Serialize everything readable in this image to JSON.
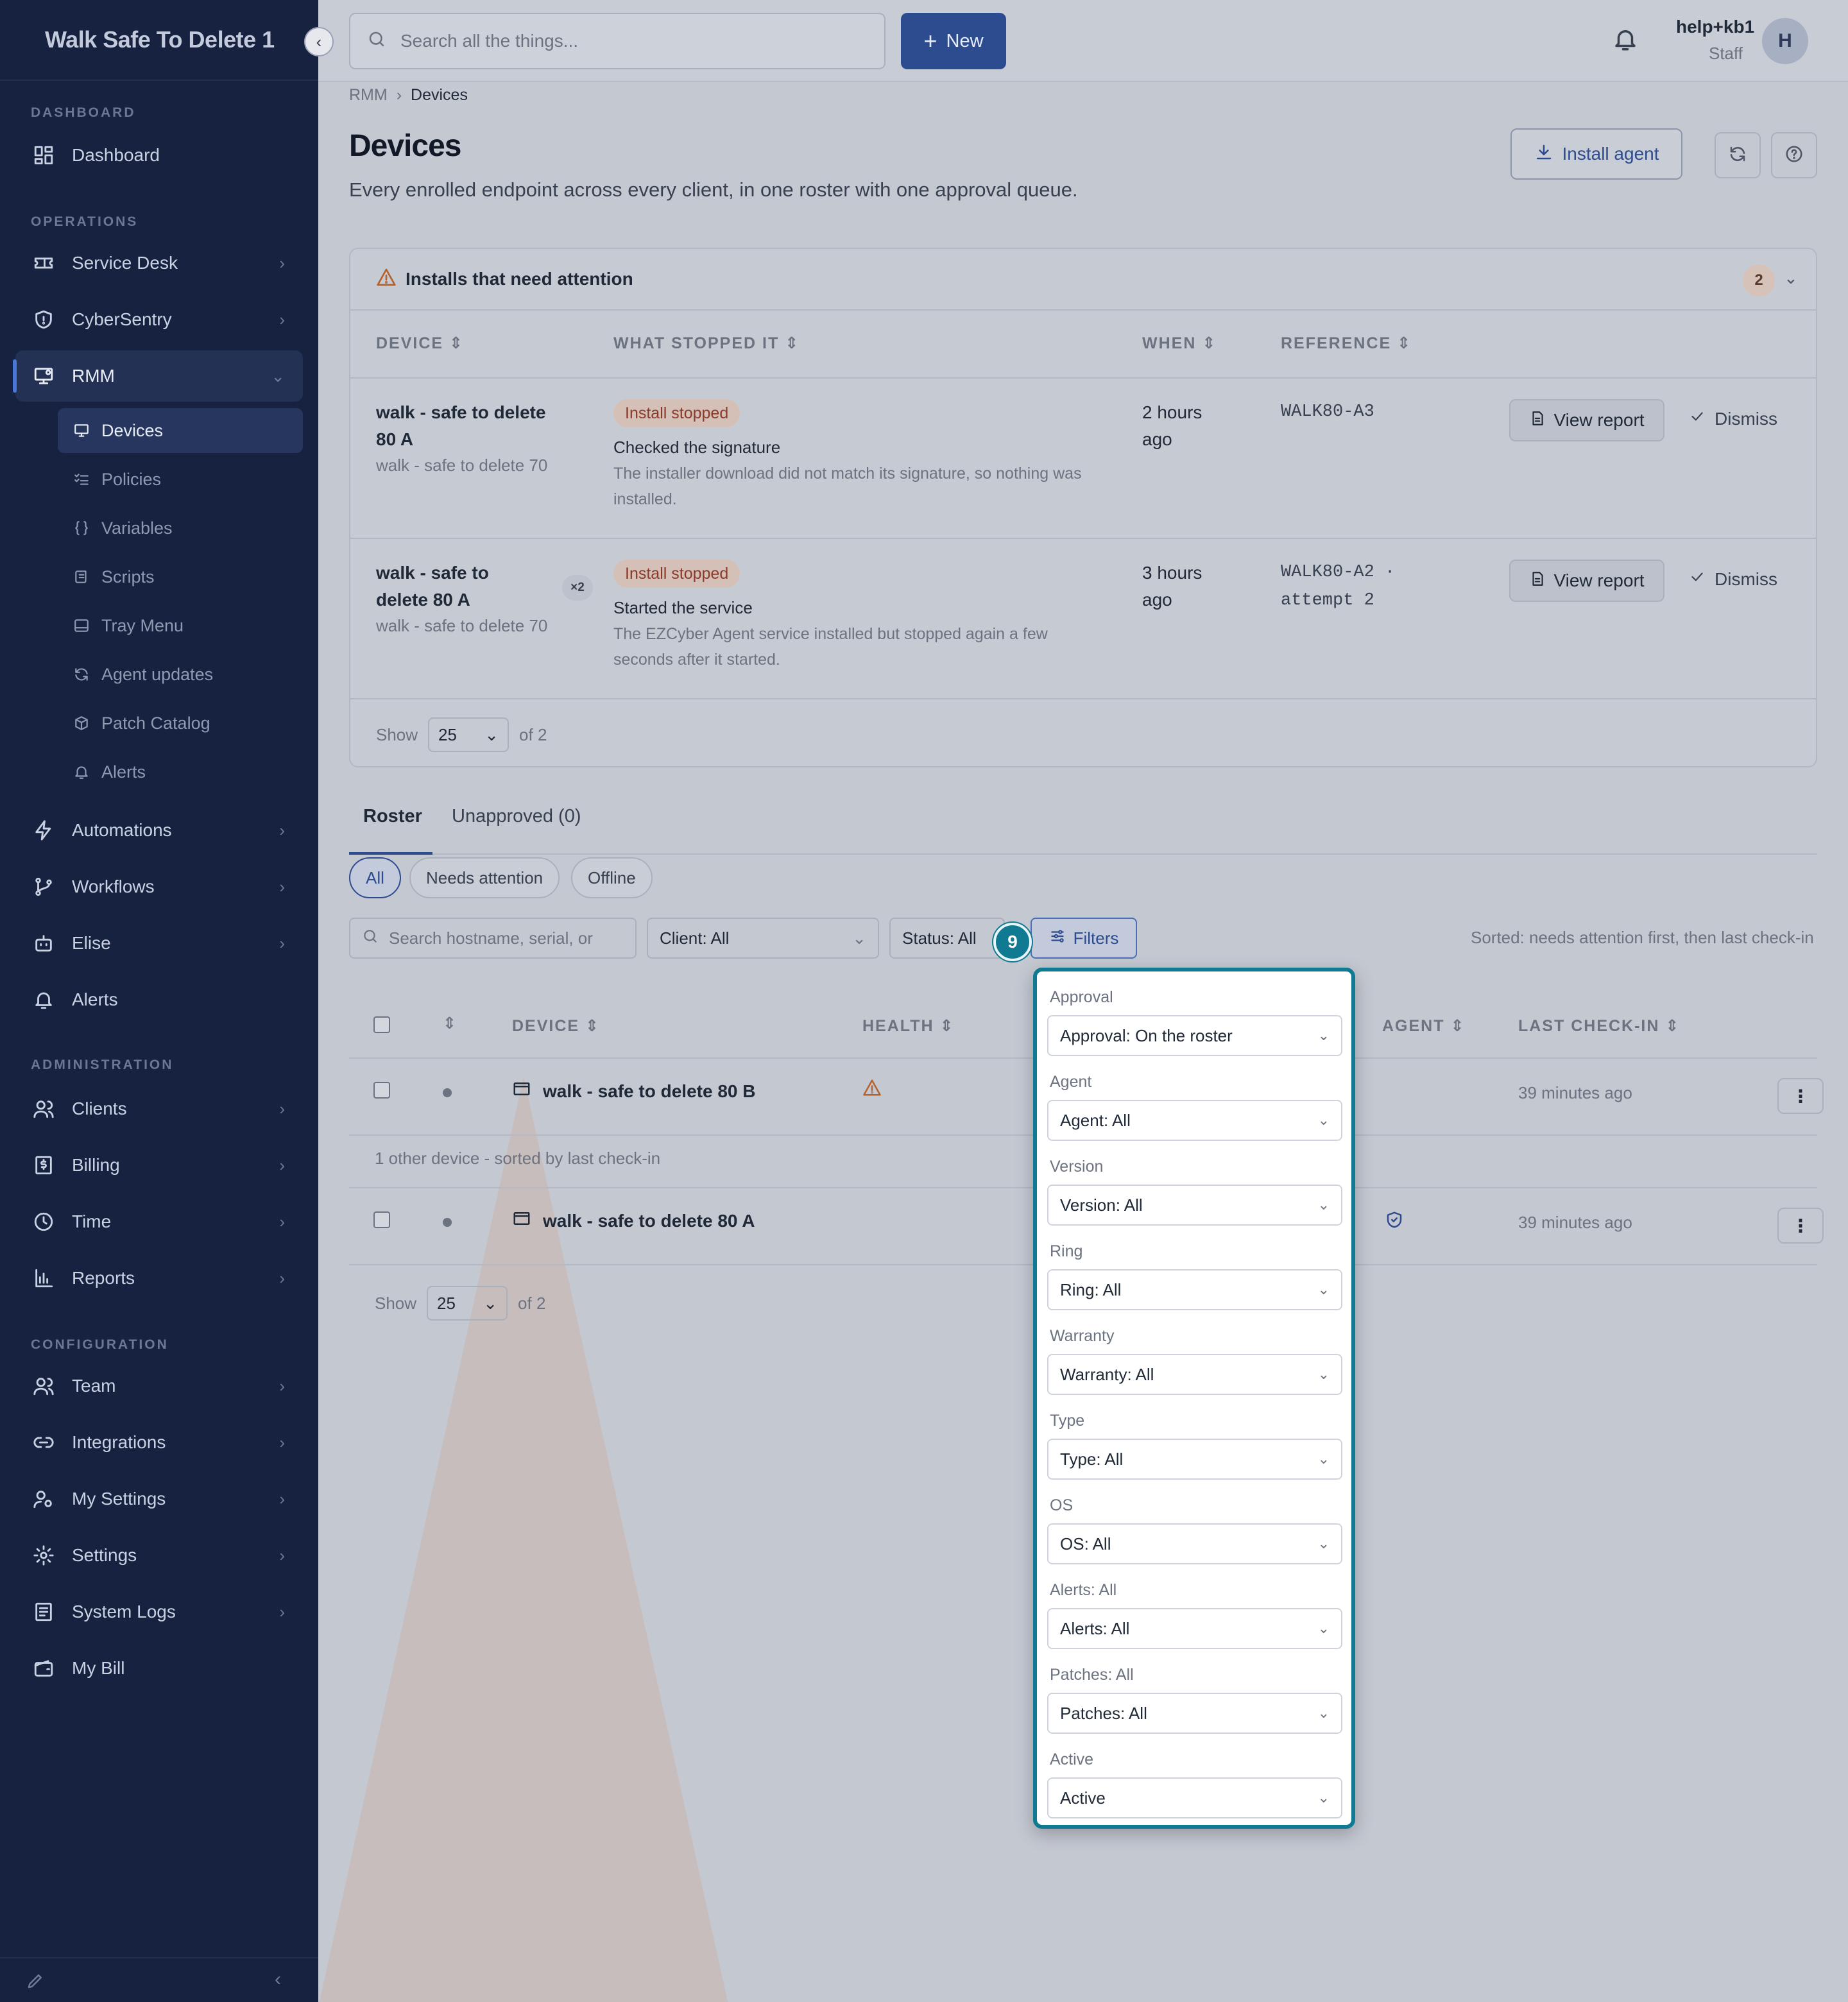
{
  "sidebar": {
    "brand": "Walk Safe To Delete 1",
    "sections": {
      "dashboard": "DASHBOARD",
      "operations": "OPERATIONS",
      "administration": "ADMINISTRATION",
      "configuration": "CONFIGURATION"
    },
    "items": {
      "dashboard": "Dashboard",
      "service_desk": "Service Desk",
      "cybersentry": "CyberSentry",
      "rmm": "RMM",
      "automations": "Automations",
      "workflows": "Workflows",
      "elise": "Elise",
      "alerts": "Alerts",
      "clients": "Clients",
      "billing": "Billing",
      "time": "Time",
      "reports": "Reports",
      "team": "Team",
      "integrations": "Integrations",
      "my_settings": "My Settings",
      "settings": "Settings",
      "system_logs": "System Logs",
      "my_bill": "My Bill"
    },
    "rmm_sub": {
      "devices": "Devices",
      "policies": "Policies",
      "variables": "Variables",
      "scripts": "Scripts",
      "tray_menu": "Tray Menu",
      "agent_updates": "Agent updates",
      "patch_catalog": "Patch Catalog",
      "alerts": "Alerts"
    }
  },
  "topbar": {
    "search_placeholder": "Search all the things...",
    "new_label": "New",
    "user_name": "help+kb1",
    "user_role": "Staff",
    "avatar_initial": "H"
  },
  "breadcrumb": {
    "parent": "RMM",
    "current": "Devices"
  },
  "page": {
    "title": "Devices",
    "subtitle": "Every enrolled endpoint across every client, in one roster with one approval queue.",
    "install_agent": "Install agent"
  },
  "attention": {
    "title": "Installs that need attention",
    "count": "2",
    "columns": {
      "device": "DEVICE",
      "what_stopped": "WHAT STOPPED IT",
      "when": "WHEN",
      "reference": "REFERENCE"
    },
    "rows": [
      {
        "device": "walk - safe to delete 80 A",
        "client": "walk - safe to delete 70",
        "status": "Install stopped",
        "step": "Checked the signature",
        "detail": "The installer download did not match its signature, so nothing was installed.",
        "when": "2 hours ago",
        "reference": "WALK80-A3",
        "view_report": "View report",
        "dismiss": "Dismiss"
      },
      {
        "device": "walk - safe to delete 80 A",
        "badge": "×2",
        "client": "walk - safe to delete 70",
        "status": "Install stopped",
        "step": "Started the service",
        "detail": "The EZCyber Agent service installed but stopped again a few seconds after it started.",
        "when": "3 hours ago",
        "reference": "WALK80-A2 · attempt 2",
        "view_report": "View report",
        "dismiss": "Dismiss"
      }
    ],
    "pager": {
      "show": "Show",
      "size": "25",
      "of": "of 2"
    }
  },
  "tabs": {
    "roster": "Roster",
    "unapproved": "Unapproved (0)"
  },
  "chips": {
    "all": "All",
    "needs_attention": "Needs attention",
    "offline": "Offline"
  },
  "filters_bar": {
    "search_placeholder": "Search hostname, serial, or",
    "client": "Client: All",
    "status": "Status: All",
    "filters": "Filters",
    "step_badge": "9",
    "sorted": "Sorted: needs attention first, then last check-in"
  },
  "roster": {
    "columns": {
      "device": "DEVICE",
      "health": "HEALTH",
      "agent": "AGENT",
      "last_checkin": "LAST CHECK-IN"
    },
    "rows": [
      {
        "device": "walk - safe to delete 80 B",
        "checkin": "39 minutes ago"
      },
      {
        "device": "walk - safe to delete 80 A",
        "checkin": "39 minutes ago"
      }
    ],
    "group_note": "1 other device - sorted by last check-in",
    "pager": {
      "show": "Show",
      "size": "25",
      "of": "of 2"
    }
  },
  "filters_popover": {
    "fields": [
      {
        "label": "Approval",
        "value": "Approval: On the roster"
      },
      {
        "label": "Agent",
        "value": "Agent: All"
      },
      {
        "label": "Version",
        "value": "Version: All"
      },
      {
        "label": "Ring",
        "value": "Ring: All"
      },
      {
        "label": "Warranty",
        "value": "Warranty: All"
      },
      {
        "label": "Type",
        "value": "Type: All"
      },
      {
        "label": "OS",
        "value": "OS: All"
      },
      {
        "label": "Alerts: All",
        "value": "Alerts: All"
      },
      {
        "label": "Patches: All",
        "value": "Patches: All"
      },
      {
        "label": "Active",
        "value": "Active"
      }
    ]
  }
}
